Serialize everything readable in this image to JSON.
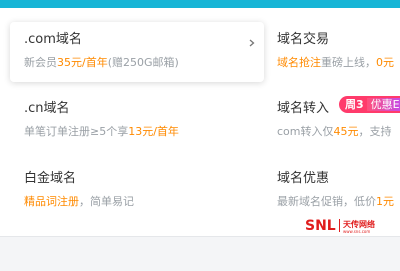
{
  "items": [
    {
      "title": ".com域名",
      "desc_pre": "新会员",
      "desc_hl": "35元/首年",
      "desc_post": "(赠250G邮箱)"
    },
    {
      "title": "域名交易",
      "desc_pre": "",
      "desc_hl": "域名抢注",
      "desc_post": "重磅上线，",
      "desc_tail_hl": "0元"
    },
    {
      "title": ".cn域名",
      "desc_pre": "单笔订单注册≥5个享",
      "desc_hl": "13元/首年",
      "desc_post": ""
    },
    {
      "title": "域名转入",
      "desc_pre": "com转入仅",
      "desc_hl": "45元",
      "desc_post": "，支持"
    },
    {
      "title": "白金域名",
      "desc_pre": "",
      "desc_hl": "精品词注册",
      "desc_post": "，简单易记"
    },
    {
      "title": "域名优惠",
      "desc_pre": "最新域名促销，低价",
      "desc_hl": "1元",
      "desc_post": ""
    }
  ],
  "badge": {
    "week": "周",
    "num": "3",
    "text": "优惠E"
  },
  "watermark": {
    "brand": "SNL",
    "cn": "天传网络",
    "url": "www.sns.com"
  },
  "colors": {
    "accent": "#17b5d6",
    "highlight": "#ff8a00",
    "badge": "#ff3b6b"
  }
}
